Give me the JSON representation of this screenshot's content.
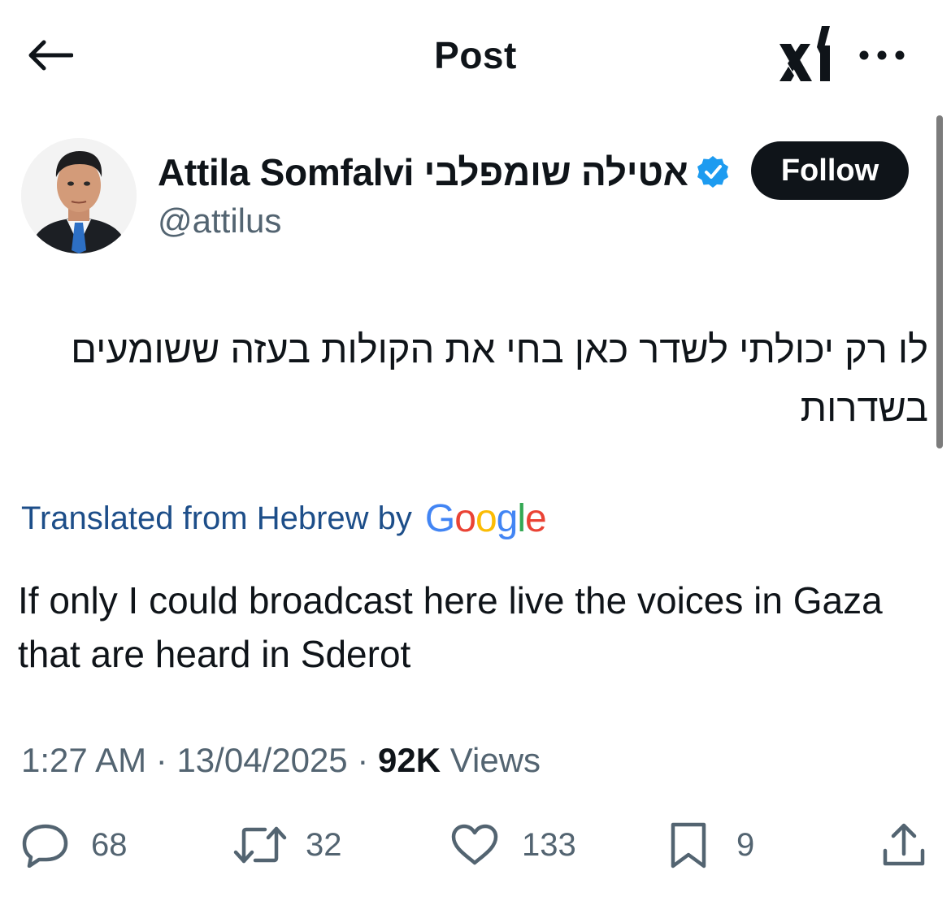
{
  "header": {
    "title": "Post",
    "back_icon": "arrow-left-icon",
    "grok_icon": "grok-xai-icon",
    "more_icon": "more-horizontal-icon"
  },
  "author": {
    "display_name": "Attila Somfalvi אטילה שומפלבי",
    "handle": "@attilus",
    "verified": true,
    "follow_label": "Follow"
  },
  "tweet": {
    "text_original": "לו רק יכולתי לשדר כאן בחי את הקולות בעזה ששומעים בשדרות",
    "translation_prefix": "Translated from Hebrew by",
    "translation_provider": "Google",
    "text_translated": "If only I could broadcast here live the voices in Gaza that are heard in Sderot"
  },
  "meta": {
    "time": "1:27 AM",
    "separator": "·",
    "date": "13/04/2025",
    "views_count": "92K",
    "views_label": "Views"
  },
  "actions": {
    "replies": "68",
    "reposts": "32",
    "likes": "133",
    "bookmarks": "9"
  },
  "colors": {
    "text": "#0f1419",
    "secondary": "#536471",
    "link": "#1d4e89",
    "verified": "#1d9bf0",
    "button_bg": "#0f1419"
  }
}
